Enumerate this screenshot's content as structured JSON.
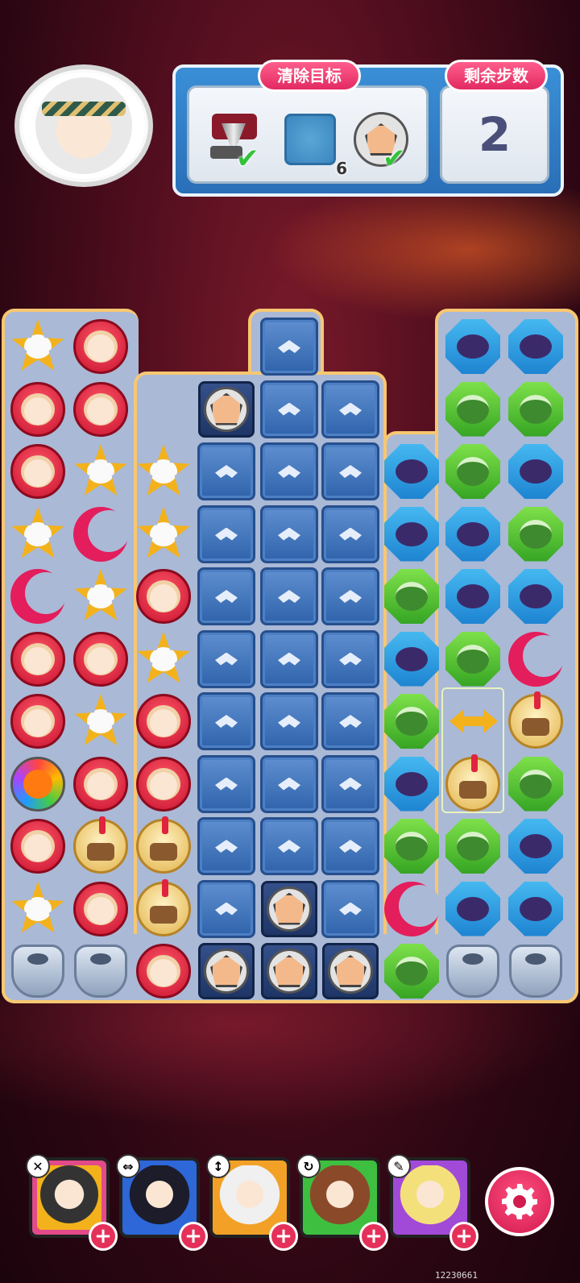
{
  "goal_panel": {
    "goal_title": "清除目标",
    "steps_title": "剩余步数",
    "steps_value": "2",
    "goals": [
      {
        "icon": "drill-icon",
        "done": true,
        "check": "✔"
      },
      {
        "icon": "ice-tile-icon",
        "count": "6"
      },
      {
        "icon": "soccer-ball-icon",
        "done": true,
        "check": "✔"
      }
    ]
  },
  "board": {
    "grid_legend": {
      "R": "red-lion-piece",
      "S": "yellow-star-piece",
      "M": "pink-moon-piece",
      "B": "blue-hex-piece",
      "G": "green-hex-piece",
      "H": "helmet-piece",
      "O": "ball-blocker",
      "P": "pot-blocker",
      "X": "rainbow-bomb",
      "A": "arrows-powerup",
      "I": "ice-tile",
      "D": "ball-on-dark-tile"
    },
    "rows": [
      [
        "S",
        "R",
        "",
        "",
        "I",
        "",
        "",
        "B",
        "B"
      ],
      [
        "R",
        "R",
        "",
        "D",
        "I",
        "I",
        "",
        "G",
        "G"
      ],
      [
        "R",
        "S",
        "S",
        "I",
        "I",
        "I",
        "B",
        "G",
        "B"
      ],
      [
        "S",
        "M",
        "S",
        "I",
        "I",
        "I",
        "B",
        "B",
        "G"
      ],
      [
        "M",
        "S",
        "R",
        "I",
        "I",
        "I",
        "G",
        "B",
        "B"
      ],
      [
        "R",
        "R",
        "S",
        "I",
        "I",
        "I",
        "B",
        "G",
        "M"
      ],
      [
        "R",
        "S",
        "R",
        "I",
        "I",
        "I",
        "G",
        "A",
        "H"
      ],
      [
        "X",
        "R",
        "R",
        "I",
        "I",
        "I",
        "B",
        "H",
        "G"
      ],
      [
        "R",
        "H",
        "H",
        "I",
        "I",
        "I",
        "G",
        "G",
        "B"
      ],
      [
        "S",
        "R",
        "H",
        "I",
        "D",
        "I",
        "M",
        "B",
        "B"
      ],
      [
        "P",
        "P",
        "R",
        "D",
        "D",
        "D",
        "G",
        "P",
        "P"
      ]
    ]
  },
  "heroes": [
    {
      "name": "hero-star-hat",
      "badge": "✕",
      "plus": "+"
    },
    {
      "name": "hero-hooded",
      "badge": "⇔",
      "plus": "+"
    },
    {
      "name": "hero-white-hair",
      "badge": "↕",
      "plus": "+"
    },
    {
      "name": "hero-brown-hair",
      "badge": "↻",
      "plus": "+"
    },
    {
      "name": "hero-blonde",
      "badge": "✎",
      "plus": "+"
    }
  ],
  "colors": {
    "hero_frames": [
      "#e24a8a",
      "#2d67d8",
      "#f2a126",
      "#3fbf3f",
      "#a24ad8"
    ]
  },
  "build_id": "12230661"
}
